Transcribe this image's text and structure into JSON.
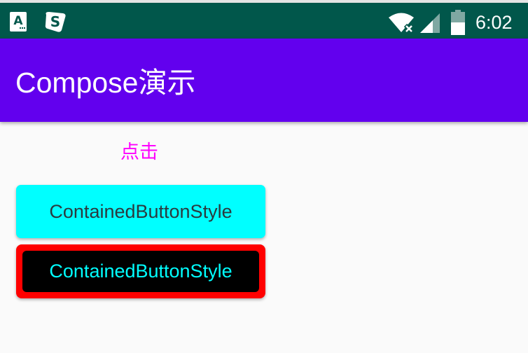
{
  "status_bar": {
    "time": "6:02",
    "icons": [
      "notification-a-icon",
      "notification-s-icon",
      "wifi-icon",
      "signal-icon",
      "battery-icon"
    ]
  },
  "app_bar": {
    "title": "Compose演示"
  },
  "content": {
    "click_label": "点击",
    "buttons": [
      {
        "label": "ContainedButtonStyle",
        "background": "#00ffff",
        "text_color": "#2b3a3f"
      },
      {
        "label": "ContainedButtonStyle",
        "background": "#000000",
        "border_color": "#ff0000",
        "text_color": "#00ffff"
      }
    ]
  },
  "colors": {
    "status_bar": "#01574b",
    "app_bar": "#6200ee",
    "accent_text": "#ff00ff",
    "page_background": "#fafafa"
  }
}
